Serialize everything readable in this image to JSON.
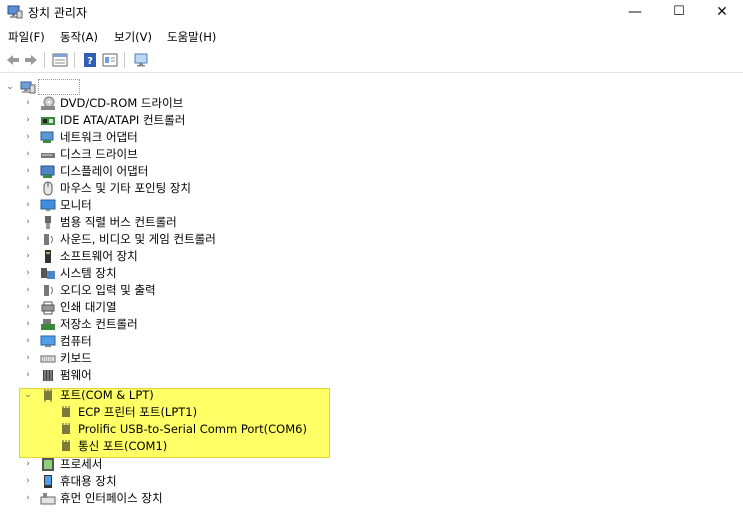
{
  "window": {
    "title": "장치 관리자",
    "minimize": "—",
    "maximize": "☐",
    "close": "✕"
  },
  "menu": [
    "파일(F)",
    "동작(A)",
    "보기(V)",
    "도움말(H)"
  ],
  "tree": {
    "root_label": "",
    "items": [
      {
        "label": "DVD/CD-ROM 드라이브",
        "icon": "dvd-drive-icon"
      },
      {
        "label": "IDE ATA/ATAPI 컨트롤러",
        "icon": "ide-controller-icon"
      },
      {
        "label": "네트워크 어댑터",
        "icon": "network-adapter-icon"
      },
      {
        "label": "디스크 드라이브",
        "icon": "disk-drive-icon"
      },
      {
        "label": "디스플레이 어댑터",
        "icon": "display-adapter-icon"
      },
      {
        "label": "마우스 및 기타 포인팅 장치",
        "icon": "mouse-icon"
      },
      {
        "label": "모니터",
        "icon": "monitor-icon"
      },
      {
        "label": "범용 직렬 버스 컨트롤러",
        "icon": "usb-icon"
      },
      {
        "label": "사운드, 비디오 및 게임 컨트롤러",
        "icon": "speaker-icon"
      },
      {
        "label": "소프트웨어 장치",
        "icon": "software-device-icon"
      },
      {
        "label": "시스템 장치",
        "icon": "system-device-icon"
      },
      {
        "label": "오디오 입력 및 출력",
        "icon": "audio-icon"
      },
      {
        "label": "인쇄 대기열",
        "icon": "printer-icon"
      },
      {
        "label": "저장소 컨트롤러",
        "icon": "storage-controller-icon"
      },
      {
        "label": "컴퓨터",
        "icon": "computer-icon"
      },
      {
        "label": "키보드",
        "icon": "keyboard-icon"
      },
      {
        "label": "펌웨어",
        "icon": "firmware-icon"
      }
    ],
    "ports": {
      "label": "포트(COM & LPT)",
      "children": [
        "ECP 프린터 포트(LPT1)",
        "Prolific USB-to-Serial Comm Port(COM6)",
        "통신 포트(COM1)"
      ]
    },
    "after": [
      {
        "label": "프로세서",
        "icon": "processor-icon"
      },
      {
        "label": "휴대용 장치",
        "icon": "portable-device-icon"
      },
      {
        "label": "휴먼 인터페이스 장치",
        "icon": "hid-icon"
      }
    ]
  },
  "colors": {
    "highlight": "#ffff66",
    "highlight_border": "#e8d23b"
  }
}
